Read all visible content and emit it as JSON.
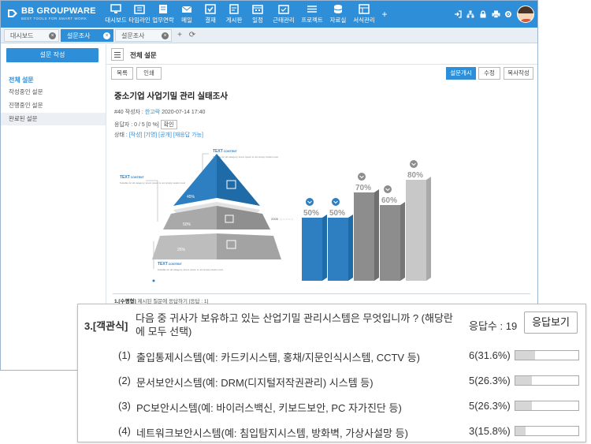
{
  "app": {
    "logo_text": "BB GROUPWARE",
    "logo_tagline": "BEST TOOLS FOR SMART WORK",
    "menu": [
      {
        "label": "대시보드",
        "icon": "monitor-icon"
      },
      {
        "label": "타임라인",
        "icon": "timeline-icon"
      },
      {
        "label": "업무연락",
        "icon": "contact-icon"
      },
      {
        "label": "메일",
        "icon": "mail-icon"
      },
      {
        "label": "결재",
        "icon": "approval-icon"
      },
      {
        "label": "게시판",
        "icon": "board-icon"
      },
      {
        "label": "일정",
        "icon": "calendar-icon"
      },
      {
        "label": "근태관리",
        "icon": "attendance-icon"
      },
      {
        "label": "프로젝트",
        "icon": "project-icon"
      },
      {
        "label": "자료실",
        "icon": "archive-icon"
      },
      {
        "label": "서식관리",
        "icon": "form-icon"
      }
    ],
    "menu_add": "+"
  },
  "tabs": [
    {
      "label": "대시보드"
    },
    {
      "label": "설문조사"
    },
    {
      "label": "설문조사"
    }
  ],
  "sidebar": {
    "create_label": "설문 작성",
    "section_title": "전체 설문",
    "items": [
      {
        "label": "작성중인 설문"
      },
      {
        "label": "진행중인 설문"
      },
      {
        "label": "완료된 설문"
      }
    ]
  },
  "content": {
    "header_title": "전체 설문",
    "list_btn": "목록",
    "print_btn": "인쇄",
    "publish_btn": "설문개시",
    "edit_btn": "수정",
    "copy_btn": "복사작성",
    "survey_title": "중소기업 사업기밀 관리 실태조사",
    "meta": {
      "id": "#40",
      "author_label": "작성자 :",
      "author": "한고락",
      "date": "2020-07-14 17:40",
      "respondents_label": "응답자 :",
      "respondents": "0 / 5 [0 %]",
      "confirm_btn": "확인",
      "status_label": "상태 :",
      "status_links": "[작성] [기명] [공개] [재응답 가능]"
    },
    "question_line_type": "1.[수평형]",
    "question_line_text": "제시된 질문에 응답하기 [응답 : 1]"
  },
  "infographic": {
    "text_heading": "TEXT",
    "text_heading_sub": "CONTENT",
    "filler": "Suitable for all category, lorem ipsum is not simply random text",
    "pyramid_pct_top": "45%",
    "pyramid_pct_mid": "50%",
    "pyramid_pct_bottom": "25%",
    "axis_label": "2005",
    "bar_labels": [
      "50%",
      "50%",
      "70%",
      "60%",
      "80%"
    ],
    "bar_fractions": [
      0.5,
      0.5,
      0.7,
      0.6,
      0.8
    ],
    "colors": {
      "blue": "#2e7fc1",
      "gray": "#8d8d8d",
      "light": "#c8c8c8"
    }
  },
  "zoom": {
    "number": "3.[객관식]",
    "question": "다음 중 귀사가 보유하고 있는 산업기밀 관리시스템은 무엇입니까 ? (해당란에 모두 선택)",
    "count_label": "응답수 : 19",
    "view_btn": "응답보기",
    "options": [
      {
        "no": "(1)",
        "label": "출입통제시스템(예: 카드키시스템, 홍채/지문인식시스템, CCTV 등)",
        "value": "6(31.6%)",
        "fraction": 0.316
      },
      {
        "no": "(2)",
        "label": "문서보안시스템(예: DRM(디지털저작권관리) 시스템 등)",
        "value": "5(26.3%)",
        "fraction": 0.263
      },
      {
        "no": "(3)",
        "label": "PC보안시스템(예: 바이러스백신, 키보드보안, PC 자가진단 등)",
        "value": "5(26.3%)",
        "fraction": 0.263
      },
      {
        "no": "(4)",
        "label": "네트워크보안시스템(예: 침입탐지시스템, 방화벽, 가상사설망 등)",
        "value": "3(15.8%)",
        "fraction": 0.158
      }
    ]
  }
}
